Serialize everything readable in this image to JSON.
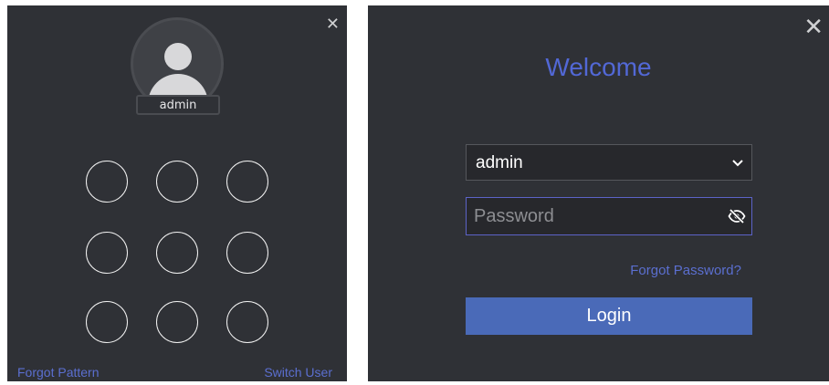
{
  "pattern_login": {
    "username": "admin",
    "forgot_pattern_label": "Forgot Pattern",
    "switch_user_label": "Switch User",
    "close_symbol": "✕",
    "pattern_dot_count": 9
  },
  "password_login": {
    "title": "Welcome",
    "user_select": {
      "value": "admin",
      "icon": "chevron-down-icon"
    },
    "password": {
      "value": "",
      "placeholder": "Password",
      "icon": "eye-off-icon"
    },
    "forgot_password_label": "Forgot Password?",
    "login_label": "Login",
    "close_symbol": "✕"
  },
  "colors": {
    "panel_bg": "#2f3136",
    "accent": "#5268d6",
    "link": "#5b6fd0",
    "login_button": "#4a6ab8",
    "password_border": "#5c63c8"
  }
}
